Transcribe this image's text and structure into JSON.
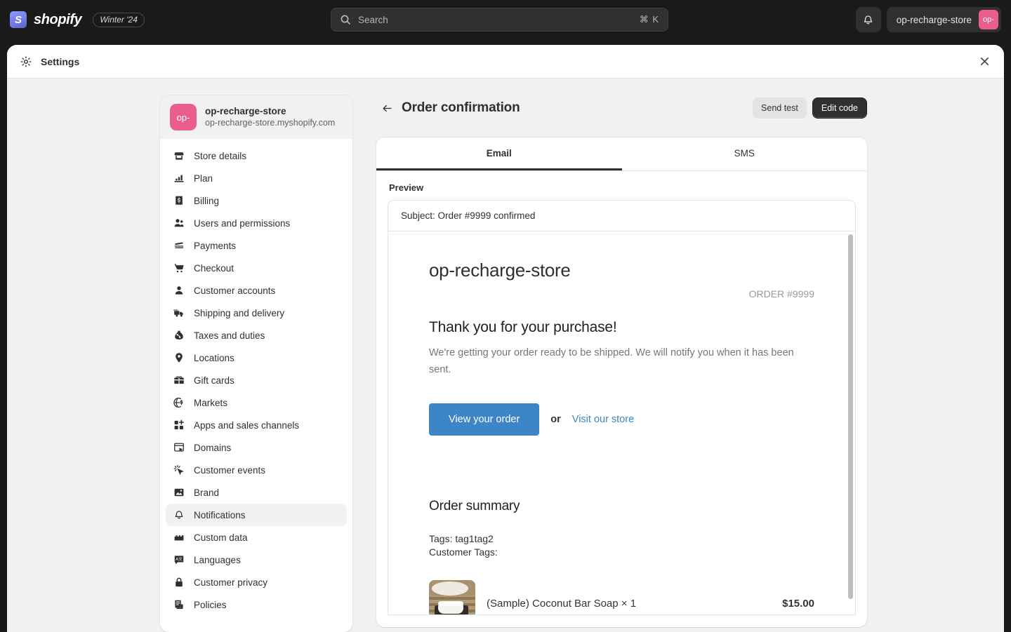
{
  "topbar": {
    "brand_name": "shopify",
    "season_badge": "Winter '24",
    "search": {
      "placeholder": "Search",
      "value": "",
      "shortcut": "⌘ K"
    },
    "notifications_icon": "bell-icon",
    "store_name": "op-recharge-store",
    "store_avatar_text": "op-",
    "store_avatar_color": "#e95e8e"
  },
  "modal": {
    "title": "Settings",
    "gear_icon": "gear-icon",
    "close_icon": "close-icon"
  },
  "sidebar": {
    "store_avatar_text": "op-",
    "store_name": "op-recharge-store",
    "store_domain": "op-recharge-store.myshopify.com",
    "items": [
      {
        "label": "Store details",
        "icon": "store-icon",
        "active": false
      },
      {
        "label": "Plan",
        "icon": "chart-icon",
        "active": false
      },
      {
        "label": "Billing",
        "icon": "receipt-icon",
        "active": false
      },
      {
        "label": "Users and permissions",
        "icon": "users-icon",
        "active": false
      },
      {
        "label": "Payments",
        "icon": "payments-icon",
        "active": false
      },
      {
        "label": "Checkout",
        "icon": "cart-icon",
        "active": false
      },
      {
        "label": "Customer accounts",
        "icon": "person-icon",
        "active": false
      },
      {
        "label": "Shipping and delivery",
        "icon": "truck-icon",
        "active": false
      },
      {
        "label": "Taxes and duties",
        "icon": "tax-icon",
        "active": false
      },
      {
        "label": "Locations",
        "icon": "pin-icon",
        "active": false
      },
      {
        "label": "Gift cards",
        "icon": "gift-card-icon",
        "active": false
      },
      {
        "label": "Markets",
        "icon": "globe-icon",
        "active": false
      },
      {
        "label": "Apps and sales channels",
        "icon": "apps-icon",
        "active": false
      },
      {
        "label": "Domains",
        "icon": "domain-icon",
        "active": false
      },
      {
        "label": "Customer events",
        "icon": "events-icon",
        "active": false
      },
      {
        "label": "Brand",
        "icon": "brand-icon",
        "active": false
      },
      {
        "label": "Notifications",
        "icon": "bell-icon",
        "active": true
      },
      {
        "label": "Custom data",
        "icon": "custom-data-icon",
        "active": false
      },
      {
        "label": "Languages",
        "icon": "translate-icon",
        "active": false
      },
      {
        "label": "Customer privacy",
        "icon": "lock-icon",
        "active": false
      },
      {
        "label": "Policies",
        "icon": "policies-icon",
        "active": false
      }
    ]
  },
  "page": {
    "back_icon": "arrow-left-icon",
    "title": "Order confirmation",
    "send_test_label": "Send test",
    "edit_code_label": "Edit code",
    "tabs": [
      {
        "label": "Email",
        "active": true
      },
      {
        "label": "SMS",
        "active": false
      }
    ],
    "preview_label": "Preview",
    "subject": "Subject: Order #9999 confirmed"
  },
  "email": {
    "store_name": "op-recharge-store",
    "order_number": "ORDER #9999",
    "heading": "Thank you for your purchase!",
    "body": "We're getting your order ready to be shipped. We will notify you when it has been sent.",
    "cta_label": "View your order",
    "or_text": "or",
    "link_label": "Visit our store",
    "link_color": "#3d85c6",
    "cta_color": "#3d85c6",
    "summary_heading": "Order summary",
    "tags_line": "Tags: tag1tag2",
    "customer_tags_line": "Customer Tags:",
    "line_items": [
      {
        "title": "(Sample) Coconut Bar Soap × 1",
        "price": "$15.00",
        "image": "coconut-bar-soap-thumbnail"
      }
    ]
  }
}
